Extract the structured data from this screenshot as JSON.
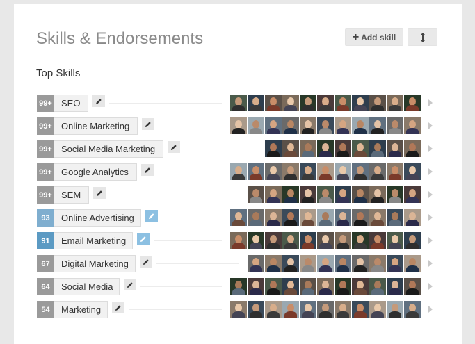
{
  "header": {
    "title": "Skills & Endorsements",
    "add_skill_label": "Add skill",
    "add_icon": "plus-icon",
    "sort_icon": "up-down-arrows-icon"
  },
  "section": {
    "title": "Top Skills"
  },
  "colors": {
    "count_gray": "#9a9a9a",
    "count_blue": "#5b9ac3",
    "edit_blue": "#8cc0e2",
    "pill_bg": "#f1f1f1"
  },
  "skills": [
    {
      "count": "99+",
      "name": "SEO",
      "faces": 11,
      "highlight": false
    },
    {
      "count": "99+",
      "name": "Online Marketing",
      "faces": 11,
      "highlight": false
    },
    {
      "count": "99+",
      "name": "Social Media Marketing",
      "faces": 9,
      "highlight": false
    },
    {
      "count": "99+",
      "name": "Google Analytics",
      "faces": 11,
      "highlight": false
    },
    {
      "count": "99+",
      "name": "SEM",
      "faces": 10,
      "highlight": false
    },
    {
      "count": "93",
      "name": "Online Advertising",
      "faces": 11,
      "highlight": true
    },
    {
      "count": "91",
      "name": "Email Marketing",
      "faces": 11,
      "highlight": true
    },
    {
      "count": "67",
      "name": "Digital Marketing",
      "faces": 10,
      "highlight": false
    },
    {
      "count": "64",
      "name": "Social Media",
      "faces": 11,
      "highlight": false
    },
    {
      "count": "54",
      "name": "Marketing",
      "faces": 11,
      "highlight": false
    }
  ],
  "footer": {
    "partial_text": ""
  }
}
